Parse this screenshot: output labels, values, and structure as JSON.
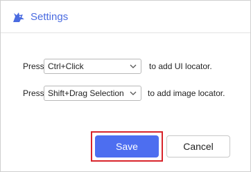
{
  "window": {
    "title": "Settings",
    "app_icon": "dragon-logo-icon"
  },
  "settings": {
    "rows": [
      {
        "prefix": "Press",
        "selected": "Ctrl+Click",
        "suffix": "to add UI locator."
      },
      {
        "prefix": "Press",
        "selected": "Shift+Drag Selection",
        "suffix": "to add image locator."
      }
    ]
  },
  "footer": {
    "save_label": "Save",
    "cancel_label": "Cancel"
  },
  "colors": {
    "accent": "#4d6ef0",
    "title": "#4a6be0",
    "highlight": "#d8232a"
  }
}
